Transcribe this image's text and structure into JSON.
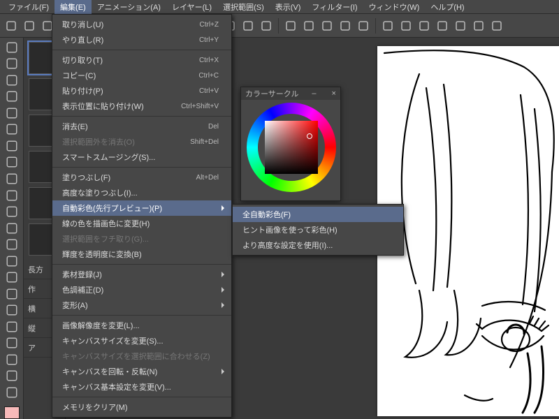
{
  "menubar": [
    "ファイル(F)",
    "編集(E)",
    "アニメーション(A)",
    "レイヤー(L)",
    "選択範囲(S)",
    "表示(V)",
    "フィルター(I)",
    "ウィンドウ(W)",
    "ヘルプ(H)"
  ],
  "menubar_open_index": 1,
  "color_panel": {
    "title": "カラーサークル"
  },
  "edit_menu": [
    {
      "t": "item",
      "label": "取り消し(U)",
      "shortcut": "Ctrl+Z"
    },
    {
      "t": "item",
      "label": "やり直し(R)",
      "shortcut": "Ctrl+Y"
    },
    {
      "t": "sep"
    },
    {
      "t": "item",
      "label": "切り取り(T)",
      "shortcut": "Ctrl+X"
    },
    {
      "t": "item",
      "label": "コピー(C)",
      "shortcut": "Ctrl+C"
    },
    {
      "t": "item",
      "label": "貼り付け(P)",
      "shortcut": "Ctrl+V"
    },
    {
      "t": "item",
      "label": "表示位置に貼り付け(W)",
      "shortcut": "Ctrl+Shift+V"
    },
    {
      "t": "sep"
    },
    {
      "t": "item",
      "label": "消去(E)",
      "shortcut": "Del"
    },
    {
      "t": "item",
      "label": "選択範囲外を消去(O)",
      "shortcut": "Shift+Del",
      "disabled": true
    },
    {
      "t": "item",
      "label": "スマートスムージング(S)..."
    },
    {
      "t": "sep"
    },
    {
      "t": "item",
      "label": "塗りつぶし(F)",
      "shortcut": "Alt+Del"
    },
    {
      "t": "item",
      "label": "高度な塗りつぶし(I)..."
    },
    {
      "t": "item",
      "label": "自動彩色(先行プレビュー)(P)",
      "sub": true,
      "hover": true
    },
    {
      "t": "item",
      "label": "線の色を描画色に変更(H)"
    },
    {
      "t": "item",
      "label": "選択範囲をフチ取り(G)...",
      "disabled": true
    },
    {
      "t": "item",
      "label": "輝度を透明度に変換(B)"
    },
    {
      "t": "sep"
    },
    {
      "t": "item",
      "label": "素材登録(J)",
      "sub": true
    },
    {
      "t": "item",
      "label": "色調補正(D)",
      "sub": true
    },
    {
      "t": "item",
      "label": "変形(A)",
      "sub": true
    },
    {
      "t": "sep"
    },
    {
      "t": "item",
      "label": "画像解像度を変更(L)..."
    },
    {
      "t": "item",
      "label": "キャンバスサイズを変更(S)..."
    },
    {
      "t": "item",
      "label": "キャンバスサイズを選択範囲に合わせる(Z)",
      "disabled": true
    },
    {
      "t": "item",
      "label": "キャンバスを回転・反転(N)",
      "sub": true
    },
    {
      "t": "item",
      "label": "キャンバス基本設定を変更(V)..."
    },
    {
      "t": "sep"
    },
    {
      "t": "item",
      "label": "メモリをクリア(M)"
    }
  ],
  "sub_menu": [
    {
      "label": "全自動彩色(F)",
      "hover": true
    },
    {
      "label": "ヒント画像を使って彩色(H)"
    },
    {
      "label": "より高度な設定を使用(I)..."
    }
  ],
  "leftpanel": {
    "row1": "長方",
    "row2": "作",
    "row3": "横",
    "row4": "縦",
    "row5": "ア"
  },
  "tool_icons": [
    "magnify",
    "move",
    "marquee",
    "lasso",
    "wand",
    "eyedrop",
    "pen",
    "brush",
    "airbrush",
    "blend",
    "eraser",
    "mix",
    "fill",
    "grad",
    "shape",
    "frame",
    "ruler",
    "text",
    "balloon",
    "slice",
    "hand",
    "zoom"
  ],
  "toolbar_icons": [
    "new",
    "open",
    "save",
    "undo",
    "redo",
    "cut",
    "copy",
    "paste",
    "img",
    "img2",
    "clip",
    "stamp",
    "anchor",
    "layers",
    "zoomin",
    "print",
    "dup",
    "rot",
    "fit",
    "crop",
    "grid",
    "guide",
    "snap",
    "flip",
    "mirror",
    "pref"
  ]
}
